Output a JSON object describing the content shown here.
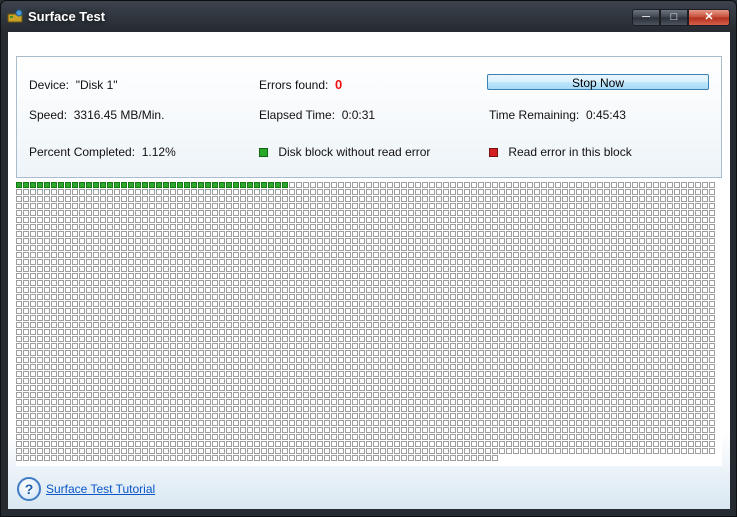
{
  "window": {
    "title": "Surface Test",
    "icons": {
      "app": "drive-test-icon",
      "minimize": "minimize-icon",
      "maximize": "maximize-icon",
      "close": "close-icon"
    }
  },
  "info": {
    "device_label": "Device:",
    "device_value": "\"Disk 1\"",
    "errors_label": "Errors found:",
    "errors_value": "0",
    "stop_button": "Stop Now",
    "speed_label": "Speed:",
    "speed_value": "3316.45 MB/Min.",
    "elapsed_label": "Elapsed Time:",
    "elapsed_value": "0:0:31",
    "remaining_label": "Time Remaining:",
    "remaining_value": "0:45:43",
    "percent_label": "Percent Completed:",
    "percent_value": "1.12%",
    "legend_ok": "Disk block without read error",
    "legend_error": "Read error in this block"
  },
  "colors": {
    "ok_block": "#2ea82c",
    "error_block": "#d42020",
    "error_text": "#e11111",
    "link": "#0a57c9"
  },
  "grid": {
    "columns": 100,
    "rows_full": 39,
    "last_row_blocks": 69,
    "tested_blocks": 39
  },
  "footer": {
    "help_icon": "help-question-icon",
    "tutorial_link": "Surface Test Tutorial"
  }
}
